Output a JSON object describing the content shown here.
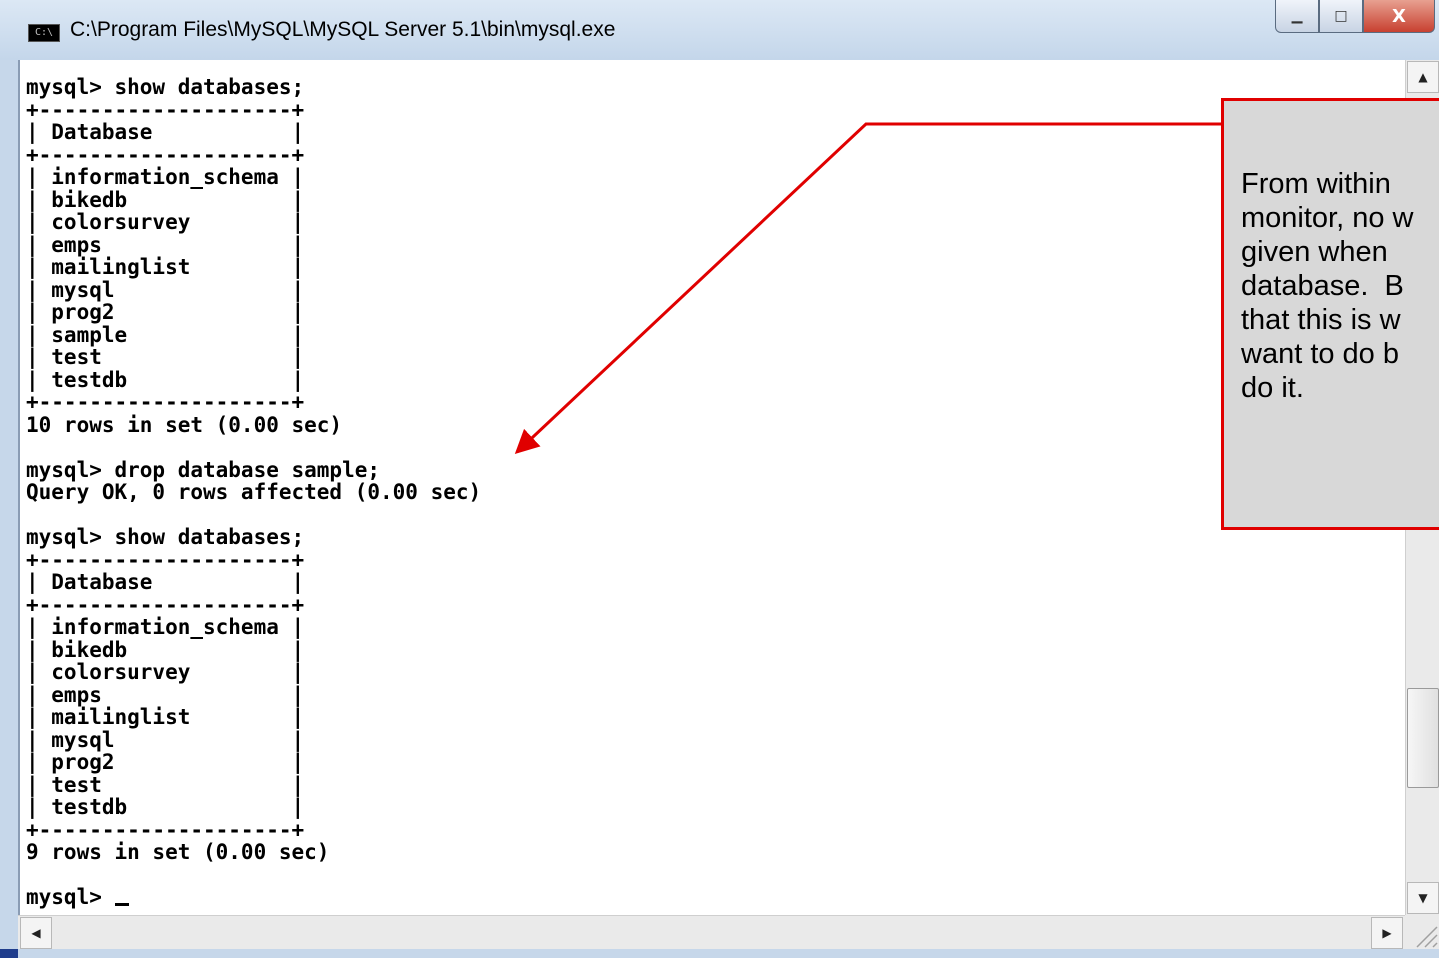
{
  "window": {
    "title": "C:\\Program Files\\MySQL\\MySQL Server 5.1\\bin\\mysql.exe",
    "icon_label": "C:\\",
    "minimize_icon": "minimize-icon",
    "maximize_icon": "maximize-icon",
    "close_icon": "close-icon",
    "minimize_glyph": "▁",
    "maximize_glyph": "□",
    "close_glyph": "X"
  },
  "console": {
    "text": "mysql> show databases;\n+--------------------+\n| Database           |\n+--------------------+\n| information_schema |\n| bikedb             |\n| colorsurvey        |\n| emps               |\n| mailinglist        |\n| mysql              |\n| prog2              |\n| sample             |\n| test               |\n| testdb             |\n+--------------------+\n10 rows in set (0.00 sec)\n\nmysql> drop database sample;\nQuery OK, 0 rows affected (0.00 sec)\n\nmysql> show databases;\n+--------------------+\n| Database           |\n+--------------------+\n| information_schema |\n| bikedb             |\n| colorsurvey        |\n| emps               |\n| mailinglist        |\n| mysql              |\n| prog2              |\n| test               |\n| testdb             |\n+--------------------+\n9 rows in set (0.00 sec)\n\n",
    "prompt": "mysql> "
  },
  "scrollbar": {
    "up_glyph": "▲",
    "down_glyph": "▼",
    "left_glyph": "◀",
    "right_glyph": "▶"
  },
  "callout": {
    "text": "From within\nmonitor, no w\ngiven when \ndatabase.  B\nthat this is w\nwant to do b\ndo it.",
    "border_color": "#e00000",
    "fill_color": "#d8d8d8"
  }
}
